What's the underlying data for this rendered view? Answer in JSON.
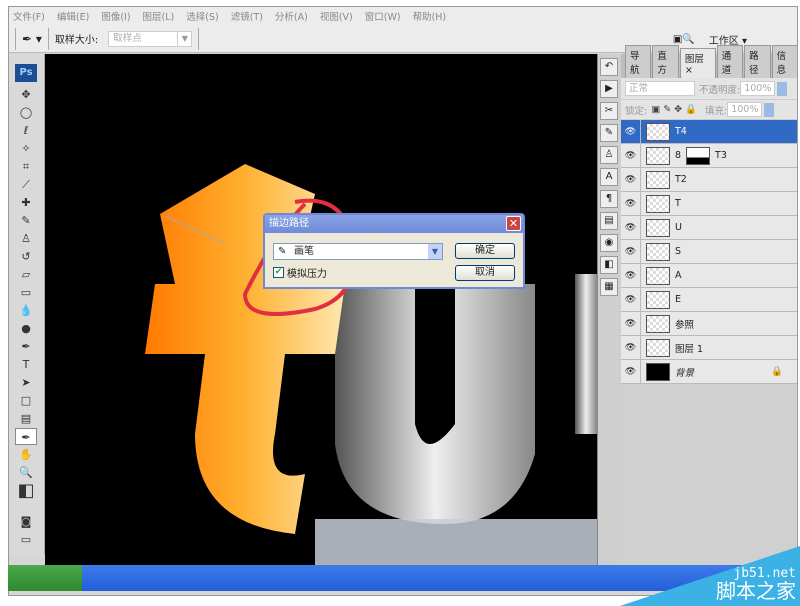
{
  "menu": [
    "文件(F)",
    "编辑(E)",
    "图像(I)",
    "图层(L)",
    "选择(S)",
    "滤镜(T)",
    "分析(A)",
    "视图(V)",
    "窗口(W)",
    "帮助(H)"
  ],
  "options": {
    "sample_size_label": "取样大小:",
    "sample_size_value": "取样点",
    "workspace": "工作区 ▾"
  },
  "toolbox": {
    "logo": "Ps"
  },
  "panel": {
    "tabs": [
      "导航",
      "直方",
      "图层",
      "通道",
      "路径",
      "信息"
    ],
    "active_tab": "图层",
    "blend_mode": "正常",
    "opacity_label": "不透明度:",
    "opacity": "100%",
    "lock_label": "锁定:",
    "fill_label": "填充:",
    "fill": "100%"
  },
  "layers": [
    {
      "name": "T4",
      "selected": true
    },
    {
      "name": "T3"
    },
    {
      "name": "T2"
    },
    {
      "name": "T"
    },
    {
      "name": "U"
    },
    {
      "name": "S"
    },
    {
      "name": "A"
    },
    {
      "name": "E"
    },
    {
      "name": "参照"
    },
    {
      "name": "图层 1"
    },
    {
      "name": "背景",
      "locked": true
    }
  ],
  "dialog": {
    "title": "描边路径",
    "tool": "画笔",
    "ok": "确定",
    "cancel": "取消",
    "simulate_pressure": "模拟压力",
    "simulate_pressure_checked": true
  },
  "watermark": {
    "url": "jb51.net",
    "name": "脚本之家"
  }
}
